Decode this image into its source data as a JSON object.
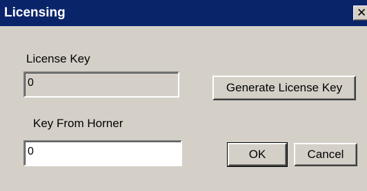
{
  "window": {
    "title": "Licensing",
    "close_glyph": "✕",
    "colors": {
      "titlebar": "#0a246a",
      "face": "#d4d0c8"
    }
  },
  "license_key": {
    "label": "License Key",
    "value": "0"
  },
  "key_from_horner": {
    "label": "Key From Horner",
    "value": "0"
  },
  "buttons": {
    "generate": "Generate License Key",
    "ok": "OK",
    "cancel": "Cancel"
  },
  "icons": [
    "close-icon"
  ]
}
